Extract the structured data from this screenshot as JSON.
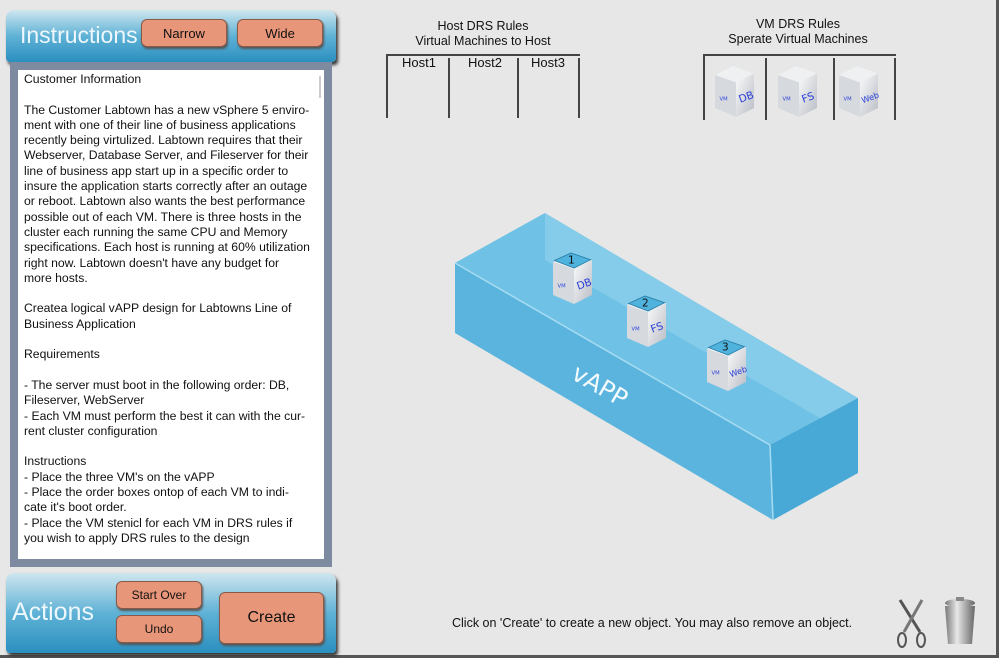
{
  "instructions_panel": {
    "title": "Instructions",
    "narrow_label": "Narrow",
    "wide_label": "Wide",
    "lines": [
      "Customer Information",
      "",
      "The Customer Labtown has a new vSphere 5 enviro-",
      "ment with one of their line of business applications",
      "recently being virtulized.  Labtown requires that their",
      "Webserver, Database Server, and Fileserver for their",
      "line of business app start up in a specific order to",
      "insure the application starts correctly after an outage",
      "or reboot.  Labtown also wants the best performance",
      "possible out of each VM.  There is three hosts in the",
      "cluster each running the same CPU and Memory",
      "specifications.  Each host is running at 60% utilization",
      "right now.   Labtown doesn't have any budget for",
      "more hosts.",
      "",
      "Createa  logical vAPP design for Labtowns Line of",
      "Business Application",
      "",
      "Requirements",
      "",
      "-  The server must boot in the following order: DB,",
      "Fileserver, WebServer",
      "-  Each VM must perform the best it can with the cur-",
      "rent cluster configuration",
      "",
      "Instructions",
      "-  Place the three VM's on the vAPP",
      "-  Place the order boxes ontop of each VM to indi-",
      "cate it's boot order.",
      "-  Place the VM stenicl for each VM in DRS rules if",
      "you wish to apply DRS rules to the design"
    ]
  },
  "actions_panel": {
    "title": "Actions",
    "start_over_label": "Start Over",
    "undo_label": "Undo",
    "create_label": "Create"
  },
  "host_drs": {
    "title1": "Host DRS Rules",
    "title2": "Virtual Machines to Host",
    "hosts": [
      "Host1",
      "Host2",
      "Host3"
    ]
  },
  "vm_drs": {
    "title1": "VM DRS Rules",
    "title2": "Sperate Virtual Machines",
    "vms": [
      {
        "tag": "VM",
        "name": "DB"
      },
      {
        "tag": "VM",
        "name": "FS"
      },
      {
        "tag": "VM",
        "name": "Web"
      }
    ]
  },
  "vapp": {
    "label": "vAPP",
    "vms": [
      {
        "order": "1",
        "tag": "VM",
        "name": "DB"
      },
      {
        "order": "2",
        "tag": "VM",
        "name": "FS"
      },
      {
        "order": "3",
        "tag": "VM",
        "name": "Web"
      }
    ]
  },
  "status_message": "Click on 'Create' to create a new object.  You may also remove an object.",
  "icons": [
    "scissors-icon",
    "trash-can-icon"
  ],
  "colors": {
    "panel_blue": "#2a8fbf",
    "button": "#e8967a",
    "vapp_blue": "#4fb0dc",
    "vm_label": "#2a3fd8"
  }
}
